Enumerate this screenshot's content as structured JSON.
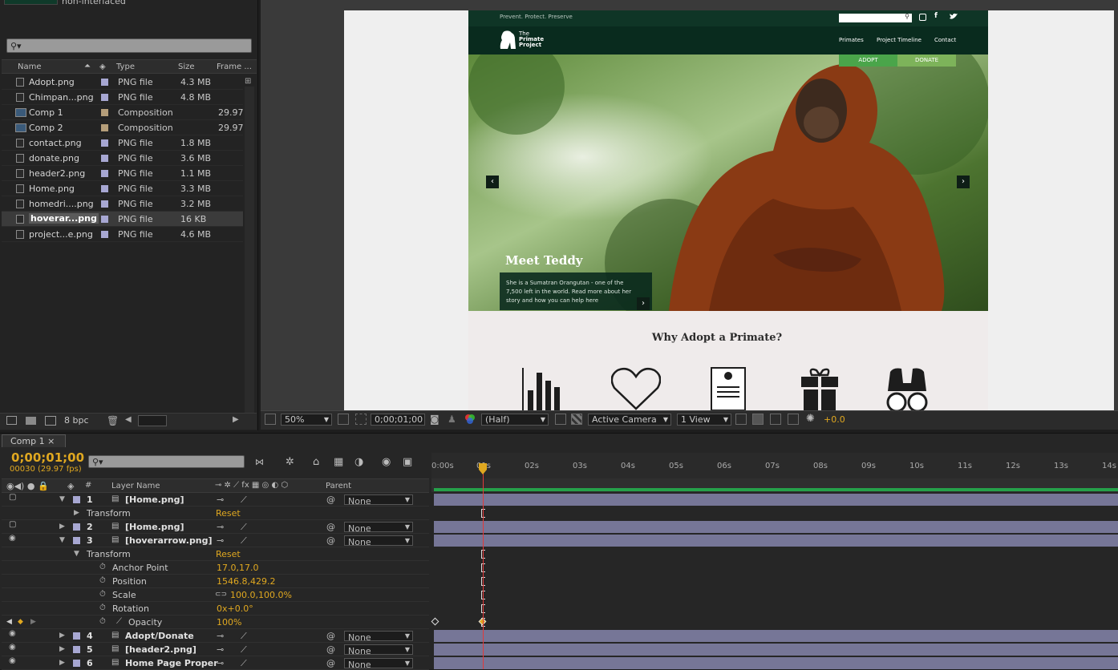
{
  "project": {
    "interlace_label": "non-interlaced",
    "search_icon": "search-icon",
    "columns": {
      "name": "Name",
      "type": "Type",
      "size": "Size",
      "frame": "Frame ..."
    },
    "items": [
      {
        "name": "Adopt.png",
        "type": "PNG file",
        "size": "4.3 MB",
        "frame": "",
        "color": "#a7a7d2",
        "kind": "file"
      },
      {
        "name": "Chimpan...png",
        "type": "PNG file",
        "size": "4.8 MB",
        "frame": "",
        "color": "#a7a7d2",
        "kind": "file"
      },
      {
        "name": "Comp 1",
        "type": "Composition",
        "size": "",
        "frame": "29.97",
        "color": "#b59e7a",
        "kind": "comp"
      },
      {
        "name": "Comp 2",
        "type": "Composition",
        "size": "",
        "frame": "29.97",
        "color": "#b59e7a",
        "kind": "comp"
      },
      {
        "name": "contact.png",
        "type": "PNG file",
        "size": "1.8 MB",
        "frame": "",
        "color": "#a7a7d2",
        "kind": "file"
      },
      {
        "name": "donate.png",
        "type": "PNG file",
        "size": "3.6 MB",
        "frame": "",
        "color": "#a7a7d2",
        "kind": "file"
      },
      {
        "name": "header2.png",
        "type": "PNG file",
        "size": "1.1 MB",
        "frame": "",
        "color": "#a7a7d2",
        "kind": "file"
      },
      {
        "name": "Home.png",
        "type": "PNG file",
        "size": "3.3 MB",
        "frame": "",
        "color": "#a7a7d2",
        "kind": "file"
      },
      {
        "name": "homedri....png",
        "type": "PNG file",
        "size": "3.2 MB",
        "frame": "",
        "color": "#a7a7d2",
        "kind": "file"
      },
      {
        "name": "hoverar...png",
        "type": "PNG file",
        "size": "16 KB",
        "frame": "",
        "color": "#a7a7d2",
        "kind": "file",
        "selected": true
      },
      {
        "name": "project...e.png",
        "type": "PNG file",
        "size": "4.6 MB",
        "frame": "",
        "color": "#a7a7d2",
        "kind": "file"
      }
    ],
    "bpc": "8 bpc"
  },
  "site": {
    "tagline": "Prevent. Protect. Preserve",
    "logo_text": [
      "The",
      "Primate",
      "Project"
    ],
    "nav": [
      "Primates",
      "Project Timeline",
      "Contact"
    ],
    "adopt": "ADOPT",
    "donate": "DONATE",
    "hero_title": "Meet Teddy",
    "hero_desc": "She is a Sumatran Orangutan - one of the 7,500 left in the world. Read more about her story and how you can help here",
    "section_title": "Why Adopt a Primate?"
  },
  "viewer": {
    "zoom": "50%",
    "timecode": "0;00;01;00",
    "resolution": "(Half)",
    "camera": "Active Camera",
    "views": "1 View",
    "exposure": "+0.0"
  },
  "timeline": {
    "tab": "Comp 1",
    "timecode": "0;00;01;00",
    "fps": "00030 (29.97 fps)",
    "col_layer_name": "Layer Name",
    "col_number": "#",
    "col_parent": "Parent",
    "ruler": [
      "0:00s",
      "01s",
      "02s",
      "03s",
      "04s",
      "05s",
      "06s",
      "07s",
      "08s",
      "09s",
      "10s",
      "11s",
      "12s",
      "13s",
      "14s"
    ],
    "layers": [
      {
        "num": "1",
        "name": "[Home.png]",
        "parent": "None"
      },
      {
        "transform": "Transform",
        "reset": "Reset"
      },
      {
        "num": "2",
        "name": "[Home.png]",
        "parent": "None"
      },
      {
        "num": "3",
        "name": "[hoverarrow.png]",
        "parent": "None"
      },
      {
        "transform": "Transform",
        "reset": "Reset"
      },
      {
        "prop": "Anchor Point",
        "value": "17.0,17.0"
      },
      {
        "prop": "Position",
        "value": "1546.8,429.2"
      },
      {
        "prop": "Scale",
        "value": "100.0,100.0%"
      },
      {
        "prop": "Rotation",
        "value": "0x+0.0°"
      },
      {
        "prop": "Opacity",
        "value": "100%"
      },
      {
        "num": "4",
        "name": "Adopt/Donate",
        "parent": "None"
      },
      {
        "num": "5",
        "name": "[header2.png]",
        "parent": "None"
      },
      {
        "num": "6",
        "name": "Home Page Proper",
        "parent": "None"
      }
    ]
  },
  "colors": {
    "accent": "#e0a820",
    "label_violet": "#a7a7d2",
    "work_area": "#25a14a",
    "playhead": "#e23a3a",
    "site_green": "#092b1e"
  }
}
